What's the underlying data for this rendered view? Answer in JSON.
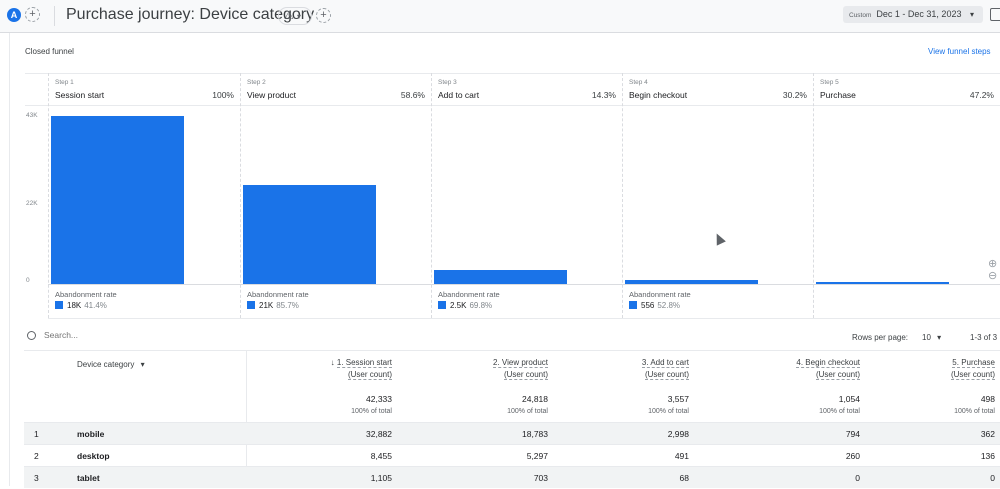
{
  "header": {
    "avatar": "A",
    "add": "+",
    "title": "Purchase journey: Device category",
    "warning_icon": "⚠",
    "caret": "▾",
    "add2": "+",
    "date_label": "Custom",
    "date_range": "Dec 1 - Dec 31, 2023",
    "date_caret": "▾"
  },
  "funnel": {
    "type_label": "Closed funnel",
    "view_steps": "View funnel steps",
    "y_ticks": [
      "43K",
      "22K",
      "0"
    ],
    "y_max": 43000,
    "abandonment_label": "Abandonment rate",
    "steps": [
      {
        "step": "Step 1",
        "name": "Session start",
        "pct": "100%",
        "users": 42333,
        "abandon_count": "18K",
        "abandon_rate": "41.4%"
      },
      {
        "step": "Step 2",
        "name": "View product",
        "pct": "58.6%",
        "users": 24818,
        "abandon_count": "21K",
        "abandon_rate": "85.7%"
      },
      {
        "step": "Step 3",
        "name": "Add to cart",
        "pct": "14.3%",
        "users": 3557,
        "abandon_count": "2.5K",
        "abandon_rate": "69.8%"
      },
      {
        "step": "Step 4",
        "name": "Begin checkout",
        "pct": "30.2%",
        "users": 1054,
        "abandon_count": "556",
        "abandon_rate": "52.8%"
      },
      {
        "step": "Step 5",
        "name": "Purchase",
        "pct": "47.2%",
        "users": 498,
        "abandon_count": "",
        "abandon_rate": ""
      }
    ],
    "zoom_in": "⊕",
    "zoom_out": "⊖",
    "bar_color": "#1a73e8"
  },
  "table": {
    "search_placeholder": "Search...",
    "rows_per_page_label": "Rows per page:",
    "rows_per_page": "10",
    "pagination": "1-3 of 3",
    "dim_header": "Device category",
    "dim_caret": "▾",
    "sort_arrow": "↓",
    "columns": [
      {
        "name": "1. Session start",
        "metric": "(User count)"
      },
      {
        "name": "2. View product",
        "metric": "(User count)"
      },
      {
        "name": "3. Add to cart",
        "metric": "(User count)"
      },
      {
        "name": "4. Begin checkout",
        "metric": "(User count)"
      },
      {
        "name": "5. Purchase",
        "metric": "(User count)"
      }
    ],
    "totals": [
      "42,333",
      "24,818",
      "3,557",
      "1,054",
      "498"
    ],
    "totals_pct": [
      "100% of total",
      "100% of total",
      "100% of total",
      "100% of total",
      "100% of total"
    ],
    "rows": [
      {
        "idx": "1",
        "device": "mobile",
        "values": [
          "32,882",
          "18,783",
          "2,998",
          "794",
          "362"
        ]
      },
      {
        "idx": "2",
        "device": "desktop",
        "values": [
          "8,455",
          "5,297",
          "491",
          "260",
          "136"
        ]
      },
      {
        "idx": "3",
        "device": "tablet",
        "values": [
          "1,105",
          "703",
          "68",
          "0",
          "0"
        ]
      }
    ]
  }
}
